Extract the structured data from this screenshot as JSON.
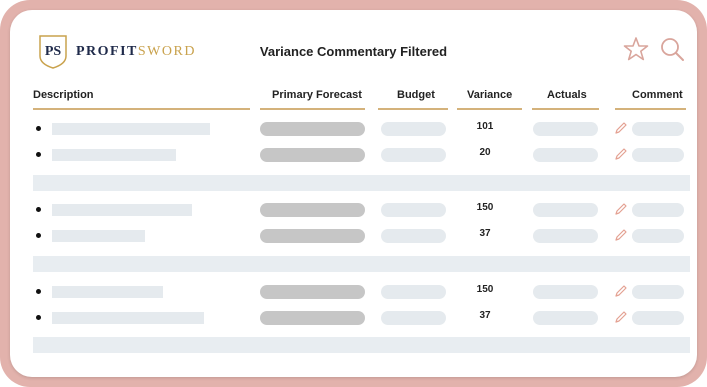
{
  "brand": {
    "part1": "PROFIT",
    "part2": "SWORD",
    "monogram": "PS"
  },
  "header": {
    "title": "Variance Commentary Filtered"
  },
  "icons": {
    "favorite": "star-outline-icon",
    "search": "search-icon",
    "edit": "pencil-icon"
  },
  "colors": {
    "frame": "#e2b2ac",
    "accent": "#d4b27b",
    "navy": "#1f2a4a",
    "gold": "#c9a24d",
    "placeholder": "#e5eaee",
    "forecast_placeholder": "#c6c6c6"
  },
  "table": {
    "columns": [
      "Description",
      "Primary Forecast",
      "Budget",
      "Variance",
      "Actuals",
      "Comment"
    ],
    "rows": [
      {
        "variance": "101"
      },
      {
        "variance": "20"
      },
      {
        "variance": "150"
      },
      {
        "variance": "37"
      },
      {
        "variance": "150"
      },
      {
        "variance": "37"
      }
    ]
  }
}
